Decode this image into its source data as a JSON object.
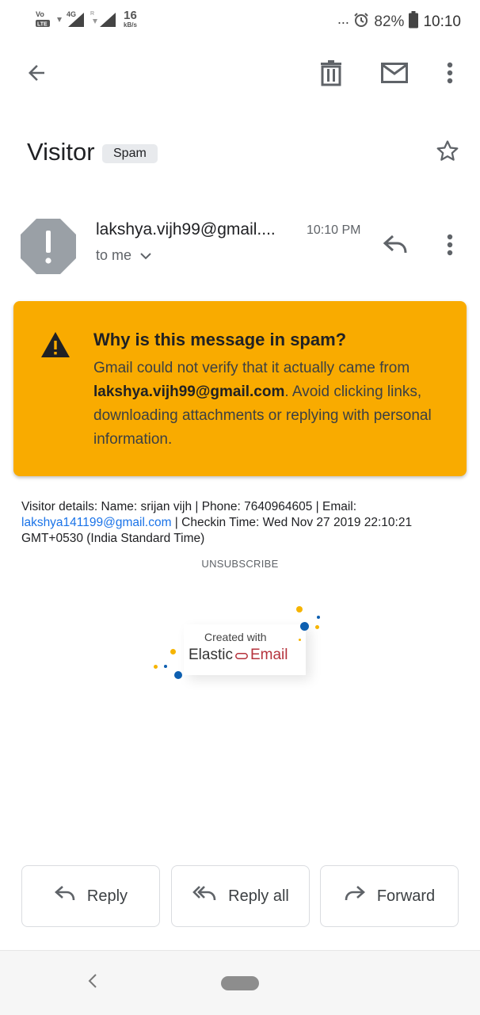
{
  "status_bar": {
    "network_label": "VoLTE",
    "network_type": "4G",
    "speed_value": "16",
    "speed_unit": "kB/s",
    "more_dots": "···",
    "battery": "82%",
    "time": "10:10"
  },
  "toolbar": {
    "back_icon": "arrow-left-icon",
    "delete_icon": "trash-icon",
    "mark_unread_icon": "mail-icon",
    "more_icon": "more-vert-icon"
  },
  "subject": {
    "title": "Visitor",
    "label": "Spam"
  },
  "message": {
    "sender": "lakshya.vijh99@gmail....",
    "time": "10:10 PM",
    "recipient": "to me"
  },
  "spam_warning": {
    "title": "Why is this message in spam?",
    "body_prefix": "Gmail could not verify that it actually came from ",
    "sender_email": "lakshya.vijh99@gmail.com",
    "body_suffix": ". Avoid clicking links, downloading attachments or replying with personal information."
  },
  "body": {
    "details_prefix": "Visitor details: Name: srijan vijh | Phone: 7640964605 | Email: ",
    "email_link": "lakshya141199@gmail.com",
    "details_suffix": " | Checkin Time: Wed Nov 27 2019 22:10:21 GMT+0530 (India Standard Time)",
    "unsubscribe": "UNSUBSCRIBE",
    "footer_created": "Created with",
    "footer_brand_1": "Elastic",
    "footer_brand_2": "Email"
  },
  "actions": {
    "reply": "Reply",
    "reply_all": "Reply all",
    "forward": "Forward"
  },
  "colors": {
    "warning_bg": "#f9ab00",
    "link": "#1a73e8",
    "brand_red": "#b5333d",
    "brand_blue": "#0d5fb0",
    "brand_yellow": "#f6b400"
  }
}
